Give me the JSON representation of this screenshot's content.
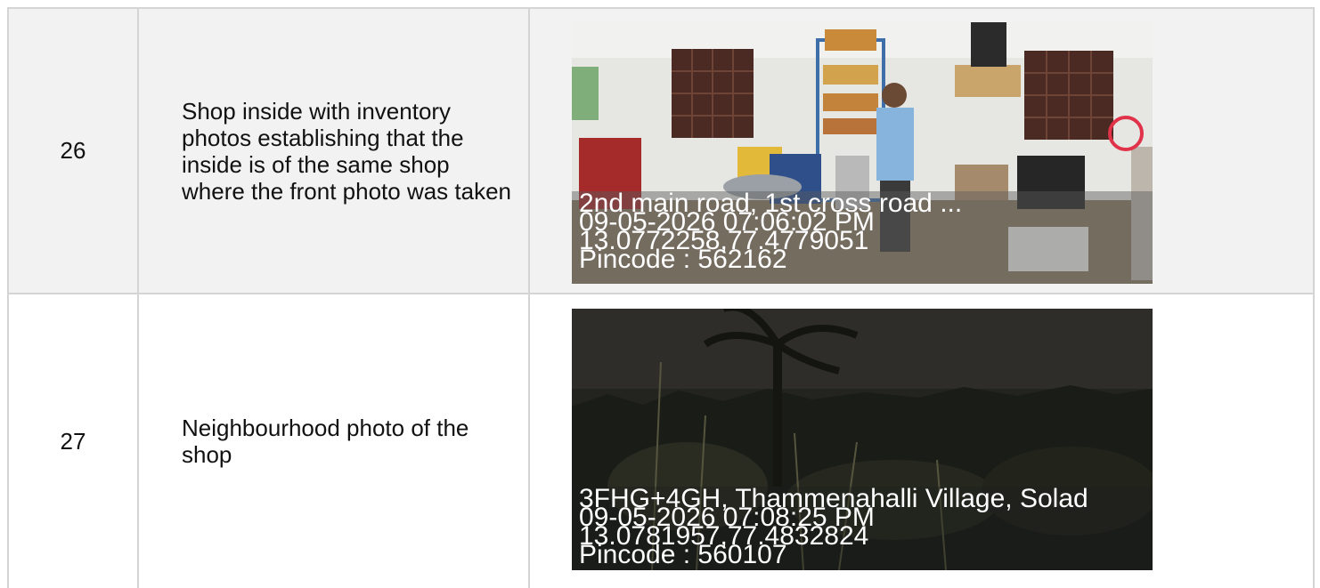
{
  "rows": [
    {
      "number": "26",
      "description": "Shop inside with inventory photos establishing that the inside is of the same shop where the front photo was taken",
      "photo": {
        "address": "2nd main road, 1st cross road ...",
        "datetime": "09-05-2026 07:06:02 PM",
        "coordinates": "13.0772258,77.4779051",
        "pincode": "Pincode : 562162"
      }
    },
    {
      "number": "27",
      "description": "Neighbourhood photo of the shop",
      "photo": {
        "address": "3FHG+4GH, Thammenahalli Village, Solad",
        "datetime": "09-05-2026 07:08:25 PM",
        "coordinates": "13.0781957,77.4832824",
        "pincode": "Pincode : 560107"
      }
    }
  ]
}
